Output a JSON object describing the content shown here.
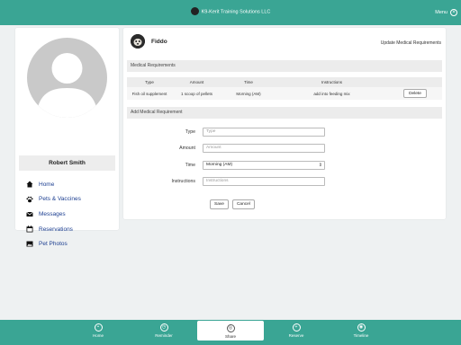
{
  "header": {
    "brand": "K9-Kerit Training Solutions LLC",
    "menu_label": "Menu"
  },
  "profile": {
    "name": "Robert Smith"
  },
  "nav": [
    {
      "label": "Home",
      "icon": "home-icon"
    },
    {
      "label": "Pets & Vaccines",
      "icon": "paw-icon"
    },
    {
      "label": "Messages",
      "icon": "envelope-icon"
    },
    {
      "label": "Reservations",
      "icon": "calendar-icon"
    },
    {
      "label": "Pet Photos",
      "icon": "image-icon"
    }
  ],
  "pet": {
    "name": "Fiddo",
    "update_link": "Update Medical Requirements"
  },
  "medical": {
    "section_title": "Medical Requirements",
    "columns": [
      "Type",
      "Amount",
      "Time",
      "Instructions"
    ],
    "rows": [
      {
        "type": "Fish oil supplement",
        "amount": "1 scoop of pellets",
        "time": "Morning (AM)",
        "instructions": "add into feeding mix",
        "action": "Delete"
      }
    ]
  },
  "add_form": {
    "section_title": "Add Medical Requirement",
    "type_label": "Type",
    "type_placeholder": "Type",
    "amount_label": "Amount",
    "amount_placeholder": "Amount",
    "time_label": "Time",
    "time_value": "Morning (AM)",
    "instructions_label": "Instructions",
    "instructions_placeholder": "Instructions",
    "save_label": "Save",
    "cancel_label": "Cancel"
  },
  "tabs": [
    {
      "label": "Home",
      "active": false
    },
    {
      "label": "Reminder",
      "active": false
    },
    {
      "label": "Share",
      "active": true
    },
    {
      "label": "Reserve",
      "active": false
    },
    {
      "label": "Timeline",
      "active": false
    }
  ],
  "colors": {
    "accent": "#3aa594",
    "nav_link": "#1d3f91"
  }
}
